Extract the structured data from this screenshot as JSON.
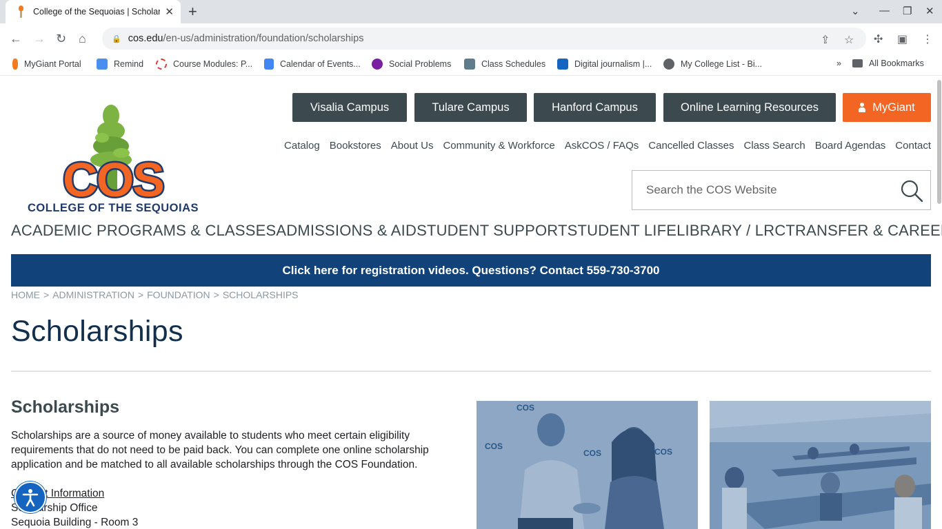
{
  "browser": {
    "tab_title": "College of the Sequoias | Scholarships",
    "url_host": "cos.edu",
    "url_path": "/en-us/administration/foundation/scholarships",
    "bookmarks": [
      {
        "label": "MyGiant Portal",
        "color": "#f47a20"
      },
      {
        "label": "Remind",
        "color": "#4a8ff0"
      },
      {
        "label": "Course Modules: P...",
        "color": "#e53935"
      },
      {
        "label": "Calendar of Events...",
        "color": "#4285f4"
      },
      {
        "label": "Social Problems",
        "color": "#7b1fa2"
      },
      {
        "label": "Class Schedules",
        "color": "#607d8b"
      },
      {
        "label": "Digital journalism |...",
        "color": "#1565c0"
      },
      {
        "label": "My College List - Bi...",
        "color": "#5f6368"
      }
    ],
    "overflow_label": "»",
    "all_bookmarks": "All Bookmarks"
  },
  "header": {
    "campus_buttons": [
      "Visalia Campus",
      "Tulare Campus",
      "Hanford Campus",
      "Online Learning Resources"
    ],
    "mygiant_label": "MyGiant",
    "util_links": [
      "Catalog",
      "Bookstores",
      "About Us",
      "Community & Workforce",
      "AskCOS / FAQs",
      "Cancelled Classes",
      "Class Search",
      "Board Agendas",
      "Contact"
    ],
    "search_placeholder": "Search the COS Website",
    "logo_letters": "COS",
    "logo_name": "COLLEGE OF THE SEQUOIAS"
  },
  "main_nav": [
    "ACADEMIC PROGRAMS & CLASSES",
    "ADMISSIONS & AID",
    "STUDENT SUPPORT",
    "STUDENT LIFE",
    "LIBRARY / LRC",
    "TRANSFER & CAREER"
  ],
  "banner": "Click here for registration videos. Questions? Contact 559-730-3700",
  "breadcrumb": [
    "HOME",
    "ADMINISTRATION",
    "FOUNDATION",
    "SCHOLARSHIPS"
  ],
  "breadcrumb_separator": ">",
  "page_title": "Scholarships",
  "content": {
    "section_title": "Scholarships",
    "intro": "Scholarships are a source of money available to students who meet certain eligibility requirements that do not need to be paid back. You can complete one online scholarship application and be matched to all available scholarships through the COS Foundation.",
    "contact_heading": "Contact Information",
    "contact_lines": [
      "Scholarship Office",
      "Sequoia Building - Room 3"
    ]
  },
  "photos": {
    "backdrop_logo_text": "COS"
  },
  "colors": {
    "campus_button": "#3c4a50",
    "mygiant": "#f26522",
    "banner": "#11437a",
    "title": "#12304e"
  }
}
